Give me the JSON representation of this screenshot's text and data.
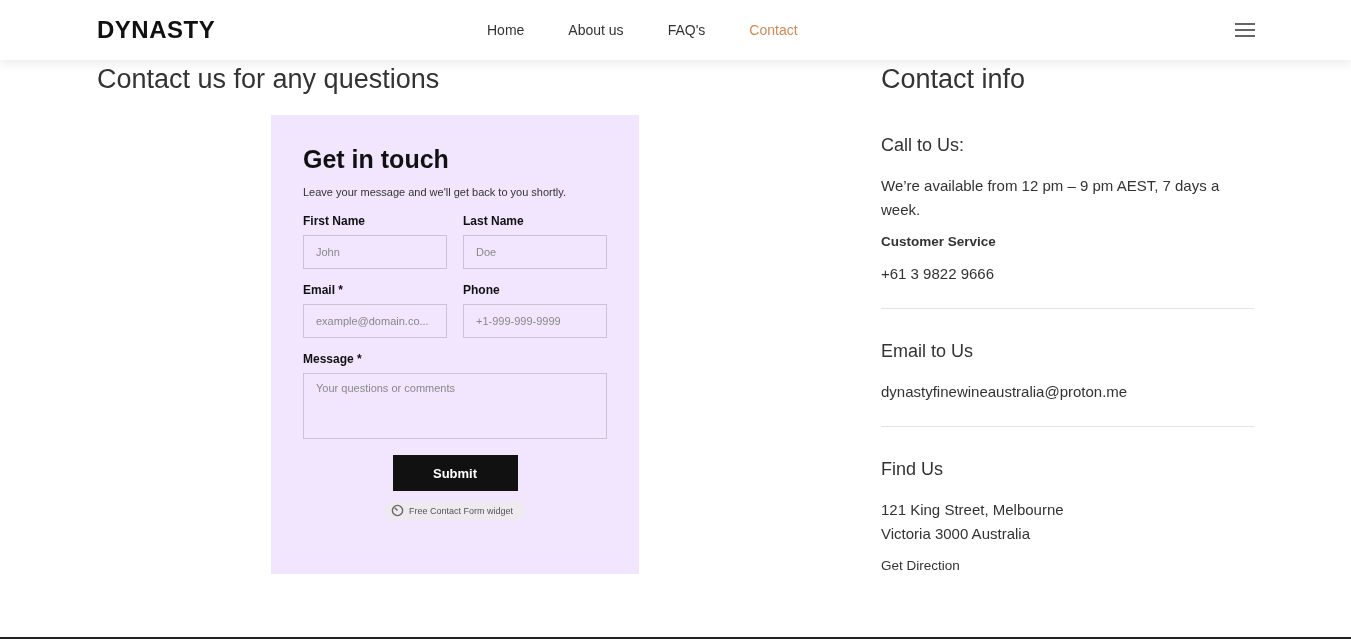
{
  "header": {
    "logo": "DYNASTY",
    "nav": [
      {
        "label": "Home",
        "selected": false
      },
      {
        "label": "About us",
        "selected": false
      },
      {
        "label": "FAQ's",
        "selected": false
      },
      {
        "label": "Contact",
        "selected": true
      }
    ]
  },
  "left": {
    "heading": "Contact us for any questions",
    "form": {
      "title": "Get in touch",
      "subtitle": "Leave your message and we'll get back to you shortly.",
      "fields": [
        {
          "kind": "input",
          "label": "First Name",
          "placeholder": "John"
        },
        {
          "kind": "input",
          "label": "Last Name",
          "placeholder": "Doe"
        },
        {
          "kind": "input",
          "label": "Email *",
          "placeholder": "example@domain.co..."
        },
        {
          "kind": "input",
          "label": "Phone",
          "placeholder": "+1-999-999-9999"
        },
        {
          "kind": "textarea",
          "label": "Message *",
          "placeholder": "Your questions or comments"
        }
      ],
      "submit": "Submit",
      "badge": "Free Contact Form widget"
    }
  },
  "right": {
    "heading": "Contact info",
    "sections": [
      {
        "title": "Call to Us:",
        "lines": [
          {
            "kind": "text",
            "text": "We’re available from 12 pm – 9 pm AEST, 7 days a week."
          },
          {
            "kind": "label",
            "text": "Customer Service"
          },
          {
            "kind": "text",
            "text": "+61 3 9822 9666"
          }
        ]
      },
      {
        "title": "Email to Us",
        "lines": [
          {
            "kind": "text",
            "text": "dynastyfinewineaustralia@proton.me"
          }
        ]
      },
      {
        "title": "Find Us",
        "lines": [
          {
            "kind": "text",
            "text": "121 King Street, Melbourne"
          },
          {
            "kind": "tight",
            "text": "Victoria 3000 Australia"
          },
          {
            "kind": "link",
            "text": "Get Direction"
          }
        ]
      }
    ]
  }
}
